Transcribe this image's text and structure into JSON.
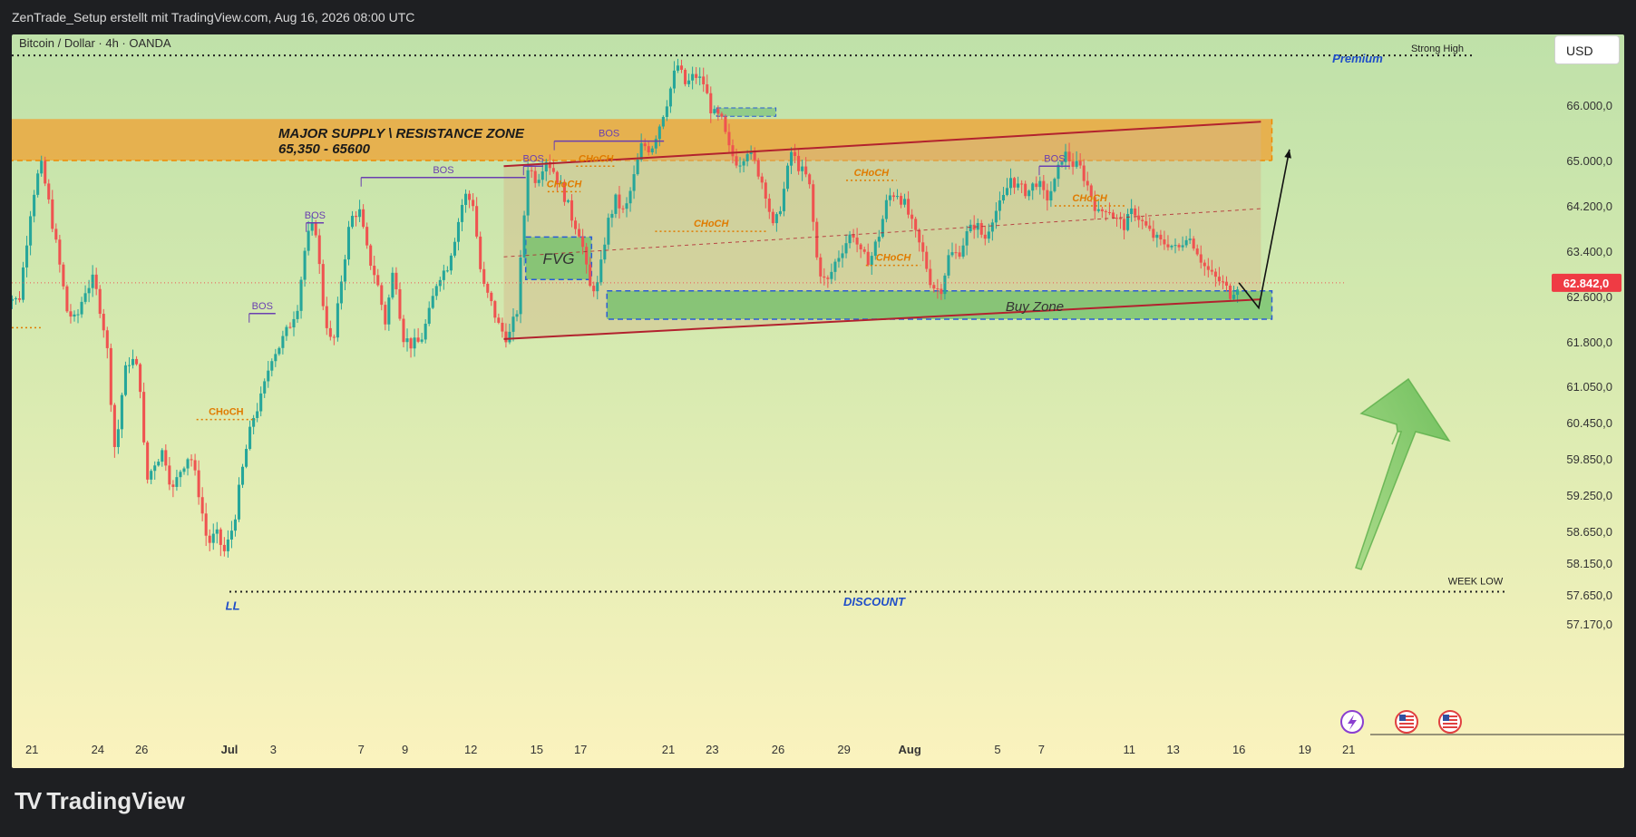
{
  "header": {
    "author_line": "ZenTrade_Setup erstellt mit TradingView.com, Aug 16, 2026 08:00 UTC"
  },
  "symbol_line": "Bitcoin / Dollar · 4h · OANDA",
  "currency_button": "USD",
  "brand": {
    "name": "TradingView",
    "mark": "TV"
  },
  "colors": {
    "bull": "#26a69a",
    "bear": "#ef5350",
    "supply_zone": "#f0a030",
    "buy_zone": "#6fbf6a",
    "channel_line": "#b2222e",
    "bos_color": "#6a3fb0",
    "choch_color": "#e07b00",
    "label_blue": "#1f4ec8",
    "price_tag": "#ef3b44"
  },
  "chart_data": {
    "type": "candlestick",
    "symbol": "Bitcoin / Dollar",
    "timeframe": "4h",
    "exchange": "OANDA",
    "current_price": 62842,
    "current_price_label": "62.842,0",
    "y_ticks": [
      {
        "value": 66000,
        "label": "66.000,0"
      },
      {
        "value": 65000,
        "label": "65.000,0"
      },
      {
        "value": 64200,
        "label": "64.200,0"
      },
      {
        "value": 63400,
        "label": "63.400,0"
      },
      {
        "value": 62600,
        "label": "62.600,0"
      },
      {
        "value": 61800,
        "label": "61.800,0"
      },
      {
        "value": 61050,
        "label": "61.050,0"
      },
      {
        "value": 60450,
        "label": "60.450,0"
      },
      {
        "value": 59850,
        "label": "59.850,0"
      },
      {
        "value": 59250,
        "label": "59.250,0"
      },
      {
        "value": 58650,
        "label": "58.650,0"
      },
      {
        "value": 58150,
        "label": "58.150,0"
      },
      {
        "value": 57650,
        "label": "57.650,0"
      },
      {
        "value": 57170,
        "label": "57.170,0"
      }
    ],
    "x_ticks": [
      {
        "t": -9,
        "label": "21",
        "bold": false
      },
      {
        "t": -6,
        "label": "24",
        "bold": false
      },
      {
        "t": -4,
        "label": "26",
        "bold": false
      },
      {
        "t": 0,
        "label": "Jul",
        "bold": true
      },
      {
        "t": 2,
        "label": "3",
        "bold": false
      },
      {
        "t": 6,
        "label": "7",
        "bold": false
      },
      {
        "t": 8,
        "label": "9",
        "bold": false
      },
      {
        "t": 11,
        "label": "12",
        "bold": false
      },
      {
        "t": 14,
        "label": "15",
        "bold": false
      },
      {
        "t": 16,
        "label": "17",
        "bold": false
      },
      {
        "t": 20,
        "label": "21",
        "bold": false
      },
      {
        "t": 22,
        "label": "23",
        "bold": false
      },
      {
        "t": 25,
        "label": "26",
        "bold": false
      },
      {
        "t": 28,
        "label": "29",
        "bold": false
      },
      {
        "t": 31,
        "label": "Aug",
        "bold": true
      },
      {
        "t": 35,
        "label": "5",
        "bold": false
      },
      {
        "t": 37,
        "label": "7",
        "bold": false
      },
      {
        "t": 41,
        "label": "11",
        "bold": false
      },
      {
        "t": 43,
        "label": "13",
        "bold": false
      },
      {
        "t": 46,
        "label": "16",
        "bold": false
      },
      {
        "t": 49,
        "label": "19",
        "bold": false
      },
      {
        "t": 51,
        "label": "21",
        "bold": false
      }
    ],
    "close_path": [
      [
        -10.2,
        62650
      ],
      [
        -9.6,
        62500
      ],
      [
        -9.0,
        64300
      ],
      [
        -8.6,
        64950
      ],
      [
        -8.3,
        64400
      ],
      [
        -7.8,
        63300
      ],
      [
        -7.4,
        62350
      ],
      [
        -7.0,
        62150
      ],
      [
        -6.6,
        62700
      ],
      [
        -6.2,
        62900
      ],
      [
        -5.9,
        62400
      ],
      [
        -5.6,
        61800
      ],
      [
        -5.2,
        59900
      ],
      [
        -4.8,
        61250
      ],
      [
        -4.5,
        61550
      ],
      [
        -4.1,
        61250
      ],
      [
        -3.8,
        59450
      ],
      [
        -3.4,
        59800
      ],
      [
        -3.0,
        60000
      ],
      [
        -2.6,
        59300
      ],
      [
        -2.2,
        59700
      ],
      [
        -1.8,
        59950
      ],
      [
        -1.4,
        59300
      ],
      [
        -1.0,
        58450
      ],
      [
        -0.6,
        58600
      ],
      [
        -0.2,
        58300
      ],
      [
        0.2,
        58800
      ],
      [
        0.7,
        59900
      ],
      [
        1.1,
        60550
      ],
      [
        1.5,
        60900
      ],
      [
        1.9,
        61550
      ],
      [
        2.3,
        61750
      ],
      [
        2.7,
        62050
      ],
      [
        3.1,
        62450
      ],
      [
        3.5,
        63600
      ],
      [
        3.9,
        63900
      ],
      [
        4.3,
        62350
      ],
      [
        4.7,
        61650
      ],
      [
        5.1,
        62900
      ],
      [
        5.5,
        63950
      ],
      [
        5.9,
        64150
      ],
      [
        6.3,
        63350
      ],
      [
        6.7,
        62900
      ],
      [
        7.1,
        62150
      ],
      [
        7.5,
        63150
      ],
      [
        7.9,
        61900
      ],
      [
        8.3,
        61750
      ],
      [
        8.7,
        61800
      ],
      [
        9.1,
        62300
      ],
      [
        9.5,
        62950
      ],
      [
        9.9,
        63100
      ],
      [
        10.3,
        63700
      ],
      [
        10.7,
        64400
      ],
      [
        11.1,
        64250
      ],
      [
        11.5,
        62850
      ],
      [
        11.9,
        62500
      ],
      [
        12.3,
        62050
      ],
      [
        12.7,
        61850
      ],
      [
        13.1,
        62350
      ],
      [
        13.6,
        64900
      ],
      [
        14.0,
        64650
      ],
      [
        14.4,
        65050
      ],
      [
        14.8,
        64800
      ],
      [
        15.2,
        64450
      ],
      [
        15.6,
        64000
      ],
      [
        16.0,
        63700
      ],
      [
        16.4,
        62750
      ],
      [
        16.8,
        62800
      ],
      [
        17.2,
        63850
      ],
      [
        17.6,
        64300
      ],
      [
        18.0,
        64050
      ],
      [
        18.4,
        64650
      ],
      [
        18.8,
        65300
      ],
      [
        19.2,
        65200
      ],
      [
        19.6,
        65650
      ],
      [
        20.0,
        66150
      ],
      [
        20.4,
        66750
      ],
      [
        20.8,
        66350
      ],
      [
        21.2,
        66550
      ],
      [
        21.6,
        66400
      ],
      [
        22.0,
        65850
      ],
      [
        22.4,
        65750
      ],
      [
        22.8,
        65150
      ],
      [
        23.2,
        64950
      ],
      [
        23.6,
        65200
      ],
      [
        24.0,
        64900
      ],
      [
        24.4,
        64500
      ],
      [
        24.8,
        63750
      ],
      [
        25.2,
        64350
      ],
      [
        25.6,
        65150
      ],
      [
        26.0,
        64850
      ],
      [
        26.4,
        64650
      ],
      [
        26.8,
        63150
      ],
      [
        27.2,
        62800
      ],
      [
        27.6,
        63200
      ],
      [
        28.0,
        63500
      ],
      [
        28.4,
        63750
      ],
      [
        28.8,
        63300
      ],
      [
        29.2,
        63250
      ],
      [
        29.6,
        63700
      ],
      [
        30.0,
        64350
      ],
      [
        30.4,
        64450
      ],
      [
        30.8,
        64200
      ],
      [
        31.2,
        63750
      ],
      [
        31.6,
        63350
      ],
      [
        32.0,
        62800
      ],
      [
        32.4,
        62700
      ],
      [
        32.8,
        63350
      ],
      [
        33.2,
        63350
      ],
      [
        33.6,
        63700
      ],
      [
        34.0,
        63900
      ],
      [
        34.4,
        63600
      ],
      [
        34.8,
        64050
      ],
      [
        35.2,
        64250
      ],
      [
        35.6,
        64700
      ],
      [
        36.0,
        64500
      ],
      [
        36.4,
        64450
      ],
      [
        36.8,
        64650
      ],
      [
        37.2,
        64300
      ],
      [
        37.6,
        64600
      ],
      [
        38.0,
        65150
      ],
      [
        38.4,
        64950
      ],
      [
        38.8,
        64850
      ],
      [
        39.2,
        64450
      ],
      [
        39.6,
        64050
      ],
      [
        40.0,
        64200
      ],
      [
        40.4,
        63950
      ],
      [
        40.8,
        63850
      ],
      [
        41.2,
        64150
      ],
      [
        41.6,
        63900
      ],
      [
        42.0,
        63700
      ],
      [
        42.4,
        63550
      ],
      [
        42.8,
        63550
      ],
      [
        43.2,
        63400
      ],
      [
        43.6,
        63700
      ],
      [
        44.0,
        63500
      ],
      [
        44.4,
        63150
      ],
      [
        44.8,
        62950
      ],
      [
        45.2,
        62850
      ],
      [
        45.6,
        62650
      ],
      [
        46.0,
        62842
      ]
    ],
    "forecast_path": [
      [
        46.0,
        62842
      ],
      [
        46.9,
        62400
      ],
      [
        48.3,
        65200
      ]
    ],
    "annotations": {
      "supply_zone": {
        "label": "MAJOR SUPPLY \\ RESISTANCE ZONE",
        "range_label": "65,350 - 65600",
        "top": 65750,
        "bottom": 65000,
        "t_start": -10.5,
        "t_end": 47.5
      },
      "buy_zone": {
        "label": "Buy Zone",
        "top": 62700,
        "bottom": 62200,
        "t_start": 17.2,
        "t_end": 47.5
      },
      "fvg": {
        "label": "FVG",
        "top": 63650,
        "bottom": 62900,
        "t_start": 13.5,
        "t_end": 16.5
      },
      "top_box": {
        "top": 65950,
        "bottom": 65800,
        "t_start": 22.2,
        "t_end": 24.9
      },
      "channel": {
        "upper": [
          [
            12.5,
            64900
          ],
          [
            47.0,
            65700
          ]
        ],
        "lower": [
          [
            12.5,
            61850
          ],
          [
            47.0,
            62550
          ]
        ],
        "mid": [
          [
            12.5,
            63300
          ],
          [
            47.0,
            64150
          ]
        ]
      },
      "premium_label": "Premium",
      "discount_label": "DISCOUNT",
      "strong_high_label": "Strong High",
      "strong_high_value": 66900,
      "week_low_label": "WEEK LOW",
      "week_low_value": 57700,
      "ll_label": "LL",
      "bos_label": "BOS",
      "choch_label": "CHoCH",
      "bos_marks": [
        {
          "t1": 0.9,
          "t2": 2.1,
          "value": 62300
        },
        {
          "t1": 3.5,
          "t2": 4.3,
          "value": 63900
        },
        {
          "t1": 6.0,
          "t2": 13.5,
          "value": 64700
        },
        {
          "t1": 13.4,
          "t2": 14.3,
          "value": 64900
        },
        {
          "t1": 14.8,
          "t2": 19.8,
          "value": 65350
        },
        {
          "t1": 36.9,
          "t2": 38.3,
          "value": 64900
        }
      ],
      "choch_marks": [
        {
          "t1": -1.5,
          "t2": 1.2,
          "value": 60500,
          "italic": false
        },
        {
          "t1": 15.8,
          "t2": 17.6,
          "value": 64900,
          "italic": true
        },
        {
          "t1": 14.5,
          "t2": 16.0,
          "value": 64450,
          "italic": true
        },
        {
          "t1": 19.4,
          "t2": 24.5,
          "value": 63750,
          "italic": true
        },
        {
          "t1": 28.1,
          "t2": 30.4,
          "value": 64650,
          "italic": true
        },
        {
          "t1": 29.0,
          "t2": 31.5,
          "value": 63150,
          "italic": true
        },
        {
          "t1": 37.6,
          "t2": 40.8,
          "value": 64200,
          "italic": true
        }
      ]
    }
  }
}
